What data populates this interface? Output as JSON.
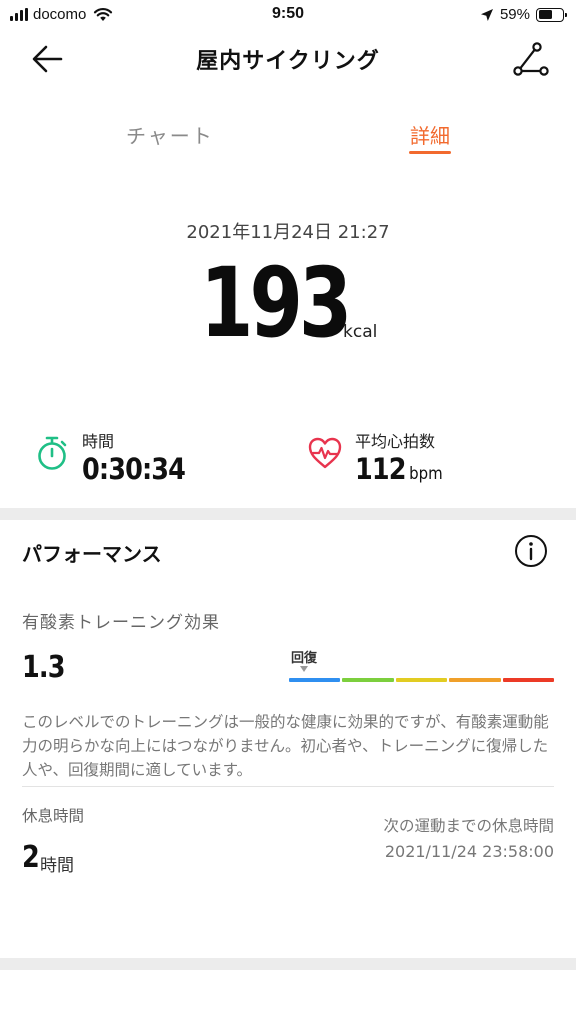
{
  "status_bar": {
    "carrier": "docomo",
    "time": "9:50",
    "battery_percent": "59%",
    "battery_level": 0.59
  },
  "header": {
    "title": "屋内サイクリング"
  },
  "tabs": [
    {
      "label": "チャート",
      "active": false
    },
    {
      "label": "詳細",
      "active": true
    }
  ],
  "summary": {
    "datetime": "2021年11月24日 21:27",
    "calories": "193",
    "calories_unit": "kcal"
  },
  "stats": {
    "time": {
      "label": "時間",
      "value": "0:30:34"
    },
    "heart_rate": {
      "label": "平均心拍数",
      "value": "112",
      "unit": "bpm"
    }
  },
  "performance": {
    "title": "パフォーマンス",
    "aerobic_label": "有酸素トレーニング効果",
    "aerobic_value": "1.3",
    "scale_label": "回復",
    "scale_colors": [
      "#2f8ff0",
      "#7ccf3d",
      "#e2cc22",
      "#f0a02a",
      "#ec3a26"
    ],
    "description": "このレベルでのトレーニングは一般的な健康に効果的ですが、有酸素運動能力の明らかな向上にはつながりません。初心者や、トレーニングに復帰した人や、回復期間に適しています。",
    "rest_label": "休息時間",
    "rest_value": "2",
    "rest_unit": "時間",
    "next_label": "次の運動までの休息時間",
    "next_value": "2021/11/24 23:58:00"
  },
  "colors": {
    "accent": "#f26a2e",
    "timer_icon": "#1fbf86",
    "heart_icon": "#e8344e"
  }
}
